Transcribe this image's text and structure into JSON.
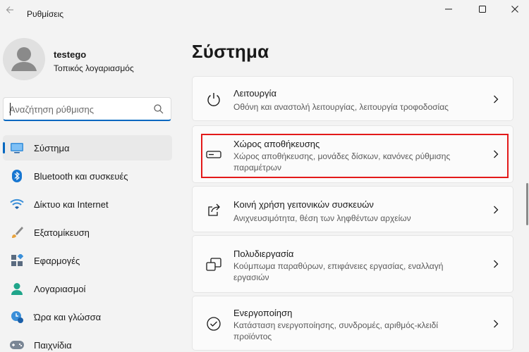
{
  "app": {
    "title": "Ρυθμίσεις"
  },
  "user": {
    "name": "testego",
    "account_type": "Τοπικός λογαριασμός"
  },
  "search": {
    "placeholder": "Αναζήτηση ρύθμισης",
    "value": ""
  },
  "nav": [
    {
      "label": "Σύστημα",
      "icon": "system-icon",
      "active": true
    },
    {
      "label": "Bluetooth και συσκευές",
      "icon": "bluetooth-icon"
    },
    {
      "label": "Δίκτυο και Internet",
      "icon": "wifi-icon"
    },
    {
      "label": "Εξατομίκευση",
      "icon": "brush-icon"
    },
    {
      "label": "Εφαρμογές",
      "icon": "apps-icon"
    },
    {
      "label": "Λογαριασμοί",
      "icon": "accounts-icon"
    },
    {
      "label": "Ώρα και γλώσσα",
      "icon": "time-language-icon"
    },
    {
      "label": "Παιχνίδια",
      "icon": "gaming-icon"
    }
  ],
  "main": {
    "title": "Σύστημα",
    "cards": [
      {
        "title": "Λειτουργία",
        "desc": "Οθόνη και αναστολή λειτουργίας, λειτουργία τροφοδοσίας",
        "icon": "power-icon"
      },
      {
        "title": "Χώρος αποθήκευσης",
        "desc": "Χώρος αποθήκευσης, μονάδες δίσκων, κανόνες ρύθμισης παραμέτρων",
        "icon": "storage-icon",
        "highlighted": true
      },
      {
        "title": "Κοινή χρήση γειτονικών συσκευών",
        "desc": "Ανιχνευσιμότητα, θέση των ληφθέντων αρχείων",
        "icon": "share-icon"
      },
      {
        "title": "Πολυδιεργασία",
        "desc": "Κούμπωμα παραθύρων, επιφάνειες εργασίας, εναλλαγή εργασιών",
        "icon": "multitasking-icon"
      },
      {
        "title": "Ενεργοποίηση",
        "desc": "Κατάσταση ενεργοποίησης, συνδρομές, αριθμός-κλειδί προϊόντος",
        "icon": "activation-icon"
      }
    ]
  },
  "colors": {
    "accent": "#0067c0",
    "highlight": "#e31a1a",
    "background": "#f3f3f3",
    "card": "#fbfbfb"
  }
}
